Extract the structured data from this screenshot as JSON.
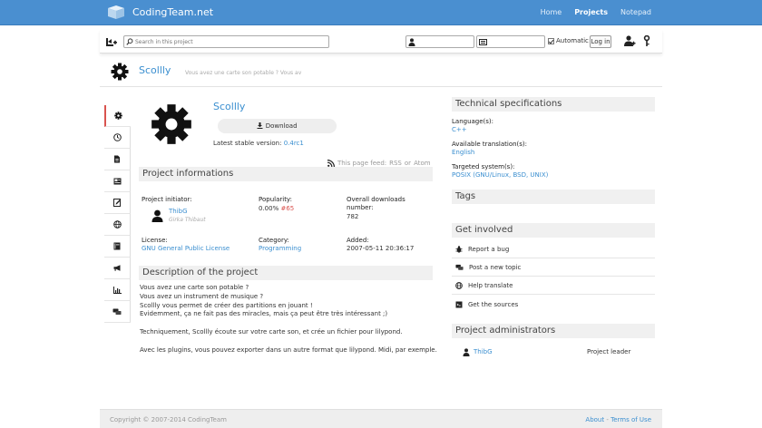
{
  "site": {
    "title": "CodingTeam.net",
    "nav": [
      "Home",
      "Projects",
      "Notepad"
    ],
    "active_nav": "Projects"
  },
  "toolbar": {
    "search_placeholder": "Search in this project",
    "automatic_label": "Automatic",
    "automatic_checked": true,
    "login_label": "Log in"
  },
  "project": {
    "name": "Scollly",
    "tagline": "Vous avez une carte son potable ? Vous av",
    "download_label": "Download",
    "latest_label": "Latest stable version:",
    "latest_version": "0.4rc1",
    "feed_label": "This page feed:",
    "feed_rss": "RSS",
    "feed_or": "or",
    "feed_atom": "Atom"
  },
  "info": {
    "heading": "Project informations",
    "initiator_label": "Project initiator:",
    "initiator_name": "ThibG",
    "initiator_realname": "Girka Thibaut",
    "popularity_label": "Popularity:",
    "popularity_pct": "0.00%",
    "popularity_rank": "#65",
    "downloads_label_1": "Overall downloads",
    "downloads_label_2": "number:",
    "downloads_value": "782",
    "license_label": "License:",
    "license_value": "GNU General Public License",
    "category_label": "Category:",
    "category_value": "Programming",
    "added_label": "Added:",
    "added_value": "2007-05-11 20:36:17"
  },
  "description": {
    "heading": "Description of the project",
    "lines": [
      "Vous avez une carte son potable ?",
      "Vous avez un instrument de musique ?",
      "Scollly vous permet de créer des partitions en jouant !",
      "Evidemment, ça ne fait pas des miracles, mais ça peut être très intéressant ;)",
      "",
      "Techniquement, Scollly écoute sur votre carte son, et crée un fichier pour lilypond.",
      "",
      "Avec les plugins, vous pouvez exporter dans un autre format que lilypond. Midi, par exemple."
    ]
  },
  "specs": {
    "heading": "Technical specifications",
    "language_label": "Language(s):",
    "language_value": "C++",
    "translation_label": "Available translation(s):",
    "translation_value": "English",
    "systems_label": "Targeted system(s):",
    "systems_value": "POSIX (GNU/Linux, BSD, UNIX)"
  },
  "tags": {
    "heading": "Tags"
  },
  "involved": {
    "heading": "Get involved",
    "items": [
      "Report a bug",
      "Post a new topic",
      "Help translate",
      "Get the sources"
    ]
  },
  "admins": {
    "heading": "Project administrators",
    "name": "ThibG",
    "role": "Project leader"
  },
  "footer": {
    "copyright": "Copyright © 2007-2014 CodingTeam",
    "about": "About",
    "sep": "-",
    "terms": "Terms of Use"
  }
}
